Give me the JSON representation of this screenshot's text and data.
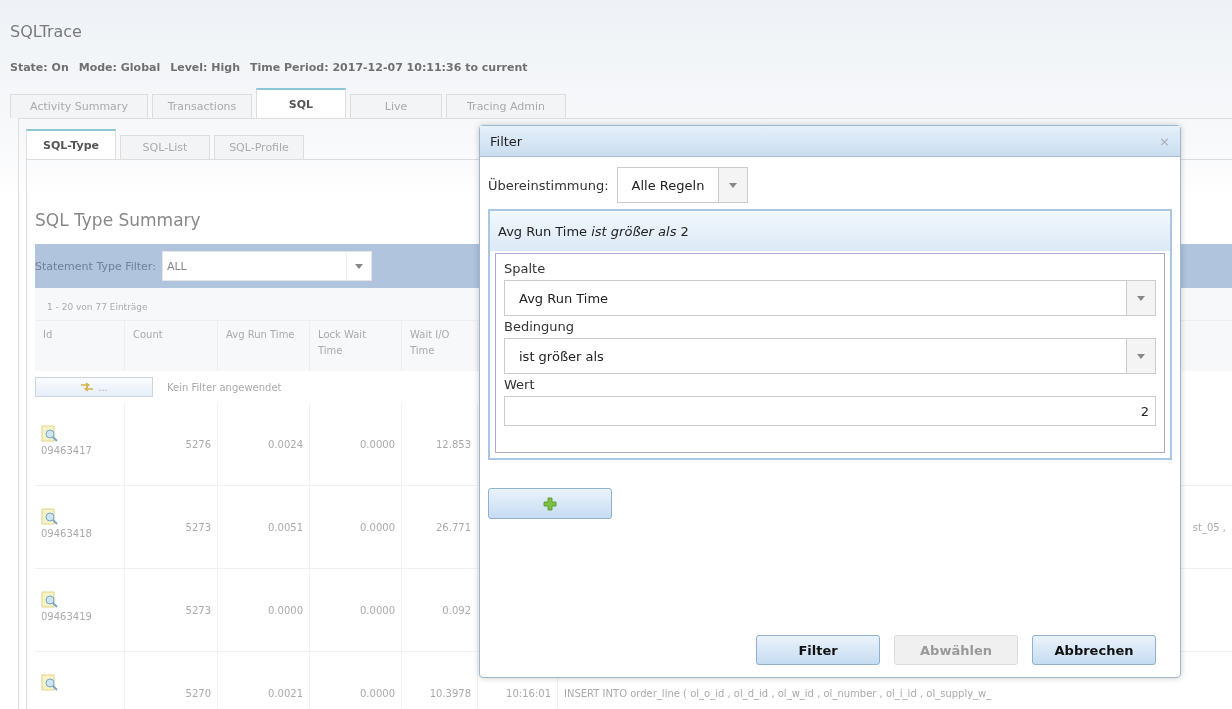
{
  "app": {
    "title": "SQLTrace"
  },
  "status": [
    "State: On",
    "Mode: Global",
    "Level: High",
    "Time Period: 2017-12-07 10:11:36 to current"
  ],
  "tabs": [
    {
      "label": "Activity Summary",
      "selected": false
    },
    {
      "label": "Transactions",
      "selected": false
    },
    {
      "label": "SQL",
      "selected": true
    },
    {
      "label": "Live",
      "selected": false
    },
    {
      "label": "Tracing Admin",
      "selected": false
    }
  ],
  "subtabs": [
    {
      "label": "SQL-Type",
      "selected": true
    },
    {
      "label": "SQL-List",
      "selected": false
    },
    {
      "label": "SQL-Profile",
      "selected": false
    }
  ],
  "section_title": "SQL Type Summary",
  "statement_filter": {
    "label": "Statement Type Filter:",
    "value": "ALL"
  },
  "table": {
    "count_text": "1 - 20 von 77 Einträge",
    "columns": [
      "Id",
      "Count",
      "Avg Run Time",
      "Lock Wait Time",
      "Wait I/O Time"
    ],
    "filter_button": "...",
    "filter_status": "Kein Filter angewendet",
    "rows": [
      {
        "cells": [
          "09463417",
          "5276",
          "0.0024",
          "0.0000",
          "12.853"
        ]
      },
      {
        "cells": [
          "09463418",
          "5273",
          "0.0051",
          "0.0000",
          "26.771"
        ],
        "sql": {
          "kind": "tail",
          "text": "st_05 ,"
        }
      },
      {
        "cells": [
          "09463419",
          "5273",
          "0.0000",
          "0.0000",
          "0.092"
        ]
      },
      {
        "cells": [
          "",
          "5270",
          "0.0021",
          "0.0000",
          "10.3978"
        ],
        "time": "10:16:01",
        "sql": {
          "kind": "head",
          "text": "INSERT INTO order_line ( ol_o_id , ol_d_id , ol_w_id , ol_number , ol_i_id , ol_supply_w_"
        }
      }
    ]
  },
  "dialog": {
    "title": "Filter",
    "close": "×",
    "match_label": "Übereinstimmung:",
    "match_value": "Alle Regeln",
    "rule": {
      "summary": "Avg Run Time *ist größer als* 2",
      "fields": [
        {
          "kind": "select",
          "label": "Spalte",
          "value": "Avg Run Time"
        },
        {
          "kind": "select",
          "label": "Bedingung",
          "value": "ist größer als"
        },
        {
          "kind": "input",
          "label": "Wert",
          "value": "2"
        }
      ]
    },
    "buttons": [
      {
        "label": "Filter",
        "disabled": false
      },
      {
        "label": "Abwählen",
        "disabled": true
      },
      {
        "label": "Abbrechen",
        "disabled": false
      }
    ]
  }
}
